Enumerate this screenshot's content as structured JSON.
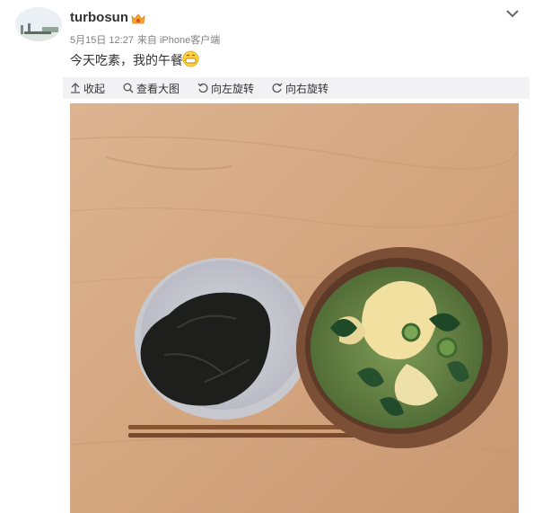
{
  "post": {
    "username": "turbosun",
    "date": "5月15日 12:27",
    "source": "来自 iPhone客户端",
    "text": "今天吃素，我的午餐",
    "emoji_icon": "grinning-face-icon",
    "vip_icon": "vip-crown-icon"
  },
  "toolbar": {
    "collapse": "收起",
    "view_large": "查看大图",
    "rotate_left": "向左旋转",
    "rotate_right": "向右旋转"
  },
  "colors": {
    "toolbar_bg": "#f2f2f5",
    "text": "#333333",
    "meta": "#808080",
    "table": "#d6a982"
  }
}
